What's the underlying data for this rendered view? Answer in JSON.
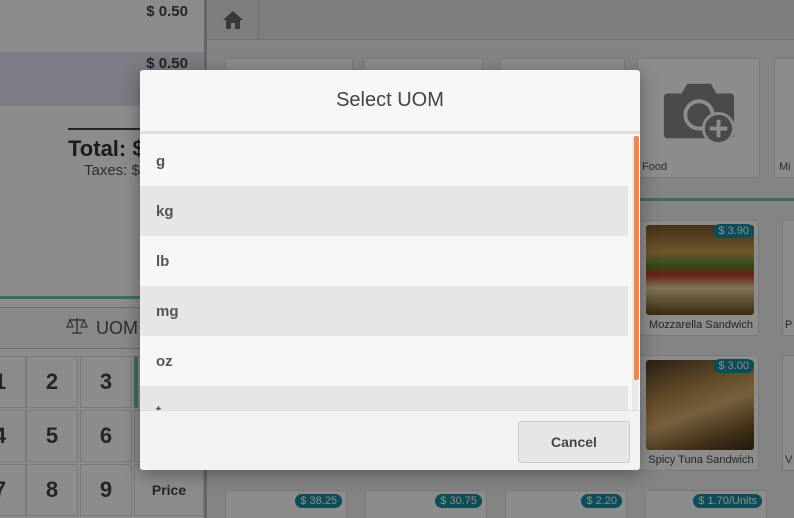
{
  "order": {
    "lines": [
      {
        "price": "$ 0.50"
      },
      {
        "price": "$ 0.50"
      }
    ],
    "total_label": "Total: $",
    "taxes_label": "Taxes: $"
  },
  "numpad": {
    "uom_label": "UOM",
    "keys": [
      "1",
      "2",
      "3",
      "4",
      "5",
      "6",
      "7",
      "8",
      "9",
      "Price"
    ]
  },
  "categories": [
    {
      "label": "Food",
      "icon": "add-camera-icon"
    },
    {
      "label": "Mi"
    }
  ],
  "products": [
    {
      "name": "Mozzarella Sandwich",
      "price": "$ 3.90"
    },
    {
      "name": "Spicy Tuna Sandwich",
      "price": "$ 3.00"
    },
    {
      "name": "",
      "price": "$ 38.25"
    },
    {
      "name": "",
      "price": "$ 30.75"
    },
    {
      "name": "",
      "price": "$ 2.20"
    },
    {
      "name": "",
      "price": "$ 1.70/Units"
    }
  ],
  "partial_labels": {
    "right_top": "P",
    "right_bottom": "V"
  },
  "dialog": {
    "title": "Select UOM",
    "items": [
      "g",
      "kg",
      "lb",
      "mg",
      "oz",
      "t"
    ],
    "cancel_label": "Cancel"
  }
}
